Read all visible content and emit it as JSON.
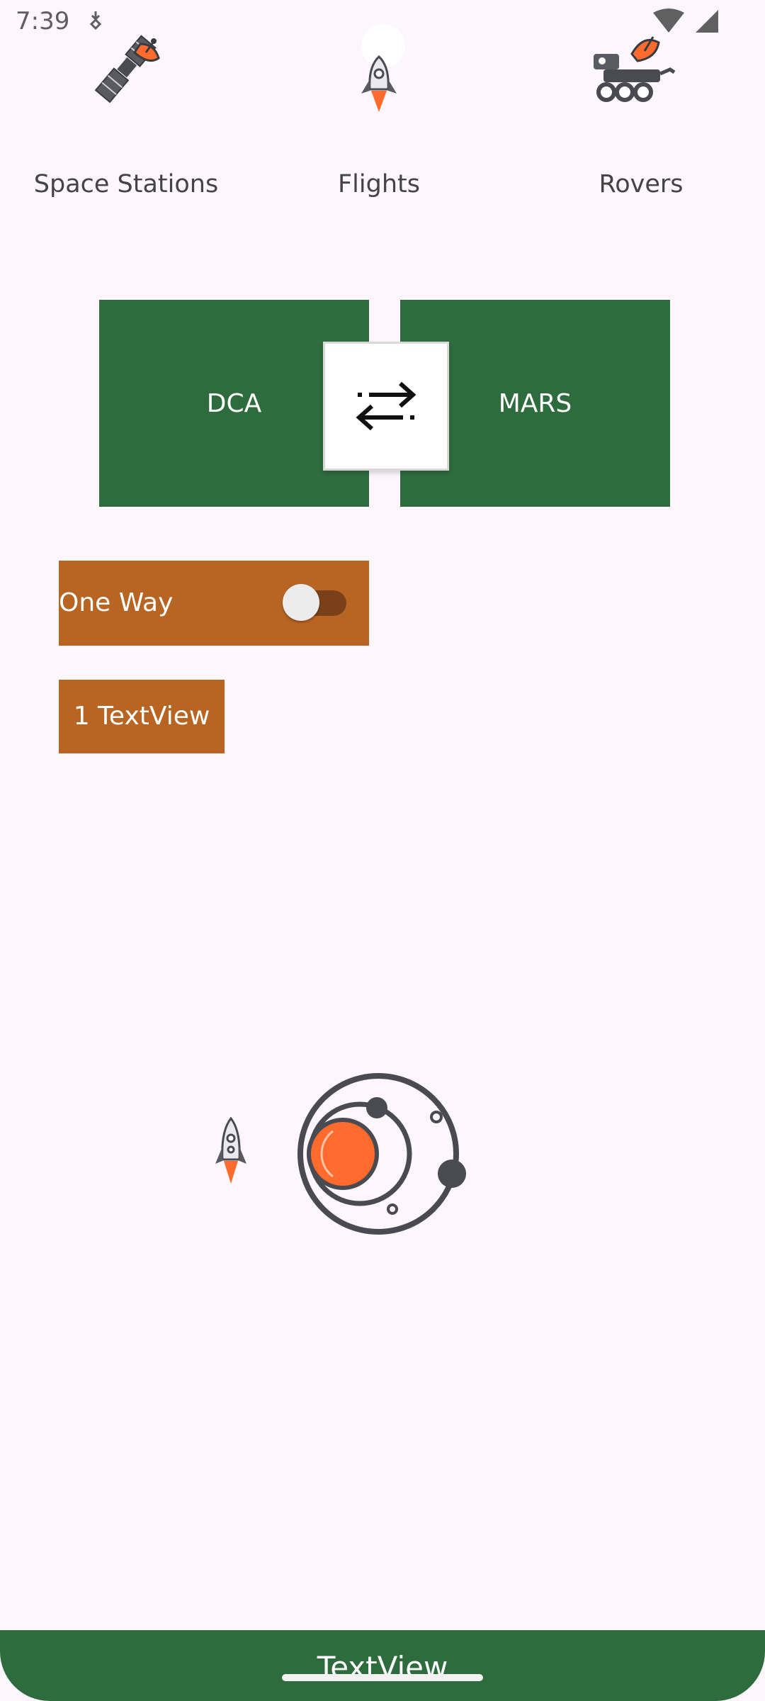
{
  "status_bar": {
    "time": "7:39"
  },
  "tabs": [
    {
      "label": "Space Stations",
      "icon": "satellite-icon"
    },
    {
      "label": "Flights",
      "icon": "rocket-icon"
    },
    {
      "label": "Rovers",
      "icon": "rover-icon"
    }
  ],
  "route": {
    "from": "DCA",
    "to": "MARS",
    "swap_icon": "swap-arrows-icon"
  },
  "trip": {
    "one_way_label": "One Way",
    "one_way_on": false
  },
  "passengers_label": "1 TextView",
  "illustration": {
    "rocket_icon": "rocket-icon",
    "planet_icon": "solar-system-icon"
  },
  "bottom_bar": {
    "label": "TextView"
  },
  "colors": {
    "green": "#2E6B3D",
    "orange": "#B86423",
    "accent": "#FF6B2C",
    "background": "#FDF6FC"
  }
}
